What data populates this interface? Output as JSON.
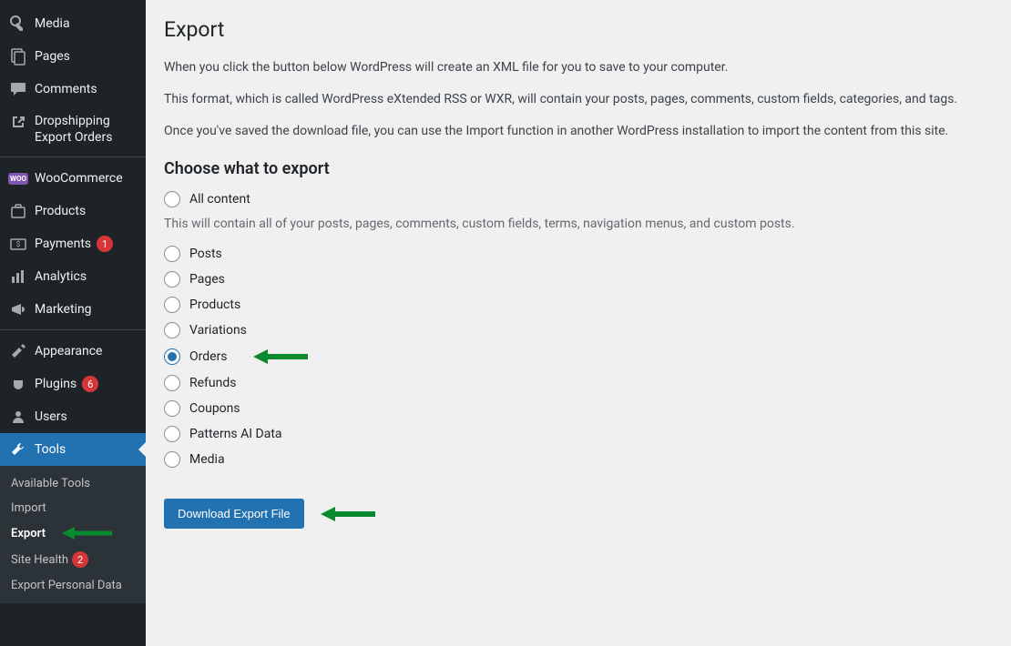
{
  "sidebar": {
    "items": [
      {
        "label": "Media",
        "icon": "media"
      },
      {
        "label": "Pages",
        "icon": "pages"
      },
      {
        "label": "Comments",
        "icon": "comments"
      },
      {
        "label": "Dropshipping Export Orders",
        "icon": "external"
      },
      {
        "label": "WooCommerce",
        "icon": "woo"
      },
      {
        "label": "Products",
        "icon": "products"
      },
      {
        "label": "Payments",
        "icon": "payments",
        "badge": "1"
      },
      {
        "label": "Analytics",
        "icon": "analytics"
      },
      {
        "label": "Marketing",
        "icon": "marketing"
      },
      {
        "label": "Appearance",
        "icon": "appearance"
      },
      {
        "label": "Plugins",
        "icon": "plugins",
        "badge": "6"
      },
      {
        "label": "Users",
        "icon": "users"
      },
      {
        "label": "Tools",
        "icon": "tools",
        "active": true
      }
    ],
    "submenu": [
      {
        "label": "Available Tools"
      },
      {
        "label": "Import"
      },
      {
        "label": "Export",
        "current": true
      },
      {
        "label": "Site Health",
        "badge": "2"
      },
      {
        "label": "Export Personal Data"
      }
    ]
  },
  "page": {
    "title": "Export",
    "p1": "When you click the button below WordPress will create an XML file for you to save to your computer.",
    "p2": "This format, which is called WordPress eXtended RSS or WXR, will contain your posts, pages, comments, custom fields, categories, and tags.",
    "p3": "Once you've saved the download file, you can use the Import function in another WordPress installation to import the content from this site.",
    "h2": "Choose what to export",
    "hint": "This will contain all of your posts, pages, comments, custom fields, terms, navigation menus, and custom posts.",
    "options": [
      {
        "label": "All content"
      },
      {
        "label": "Posts"
      },
      {
        "label": "Pages"
      },
      {
        "label": "Products"
      },
      {
        "label": "Variations"
      },
      {
        "label": "Orders",
        "checked": true
      },
      {
        "label": "Refunds"
      },
      {
        "label": "Coupons"
      },
      {
        "label": "Patterns AI Data"
      },
      {
        "label": "Media"
      }
    ],
    "download_button": "Download Export File"
  }
}
